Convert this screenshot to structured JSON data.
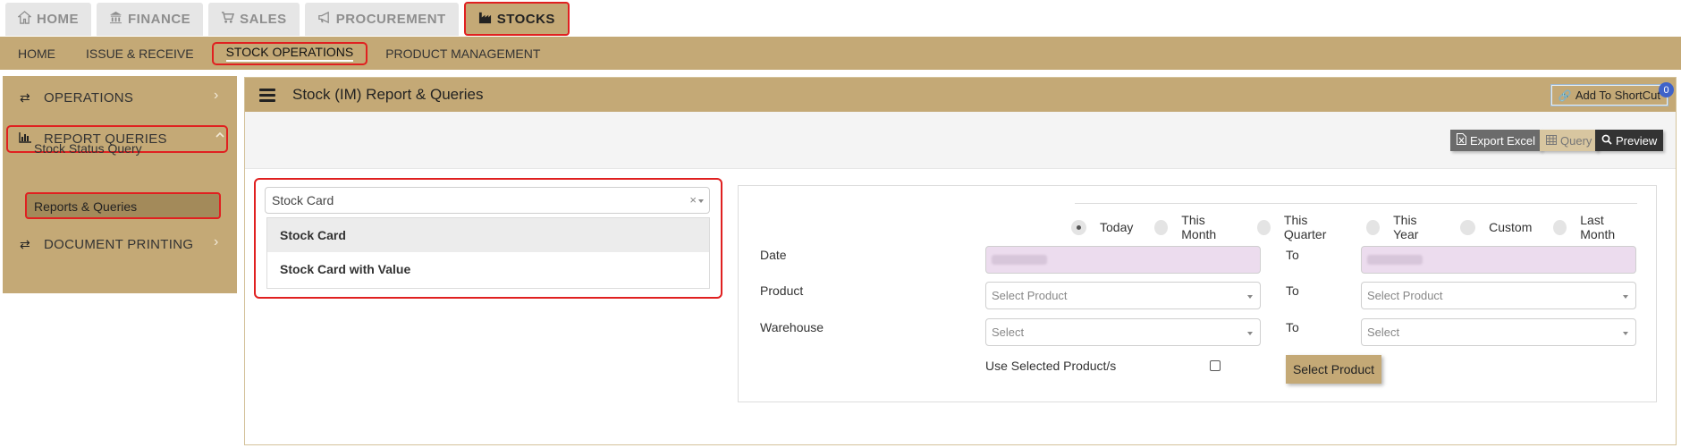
{
  "top_tabs": [
    {
      "label": "HOME",
      "icon": "home-icon"
    },
    {
      "label": "FINANCE",
      "icon": "bank-icon"
    },
    {
      "label": "SALES",
      "icon": "cart-icon"
    },
    {
      "label": "PROCUREMENT",
      "icon": "bullhorn-icon"
    },
    {
      "label": "STOCKS",
      "icon": "industry-icon",
      "active": true
    }
  ],
  "sub_nav": [
    {
      "label": "HOME"
    },
    {
      "label": "ISSUE & RECEIVE"
    },
    {
      "label": "STOCK OPERATIONS",
      "active": true
    },
    {
      "label": "PRODUCT MANAGEMENT"
    }
  ],
  "sidebar": {
    "items": [
      {
        "label": "OPERATIONS",
        "icon": "exchange-icon"
      },
      {
        "label": "REPORT QUERIES",
        "icon": "bar-chart-icon",
        "expanded": true
      },
      {
        "label": "DOCUMENT PRINTING",
        "icon": "exchange-icon"
      }
    ],
    "sub_items": [
      {
        "label": "Stock Status Query"
      },
      {
        "label": "Reports & Queries",
        "active": true
      }
    ]
  },
  "header": {
    "title": "Stock (IM) Report & Queries",
    "shortcut_label": "Add To ShortCut",
    "shortcut_count": "0"
  },
  "toolbar": {
    "export_label": "Export Excel",
    "query_label": "Query",
    "preview_label": "Preview"
  },
  "report_select": {
    "value": "Stock Card",
    "clear": "×",
    "options": [
      "Stock Card",
      "Stock Card with Value"
    ]
  },
  "filter": {
    "period_options": [
      "Today",
      "This Month",
      "This Quarter",
      "This Year",
      "Custom",
      "Last Month"
    ],
    "selected_period": "Today",
    "date_label": "Date",
    "to_label": "To",
    "product_label": "Product",
    "product_placeholder": "Select Product",
    "warehouse_label": "Warehouse",
    "warehouse_placeholder": "Select",
    "use_selected_label": "Use Selected Product/s",
    "select_product_button": "Select Product"
  },
  "colors": {
    "accent": "#c4a976",
    "highlight": "#e02020",
    "date_field": "#ecdcee"
  }
}
